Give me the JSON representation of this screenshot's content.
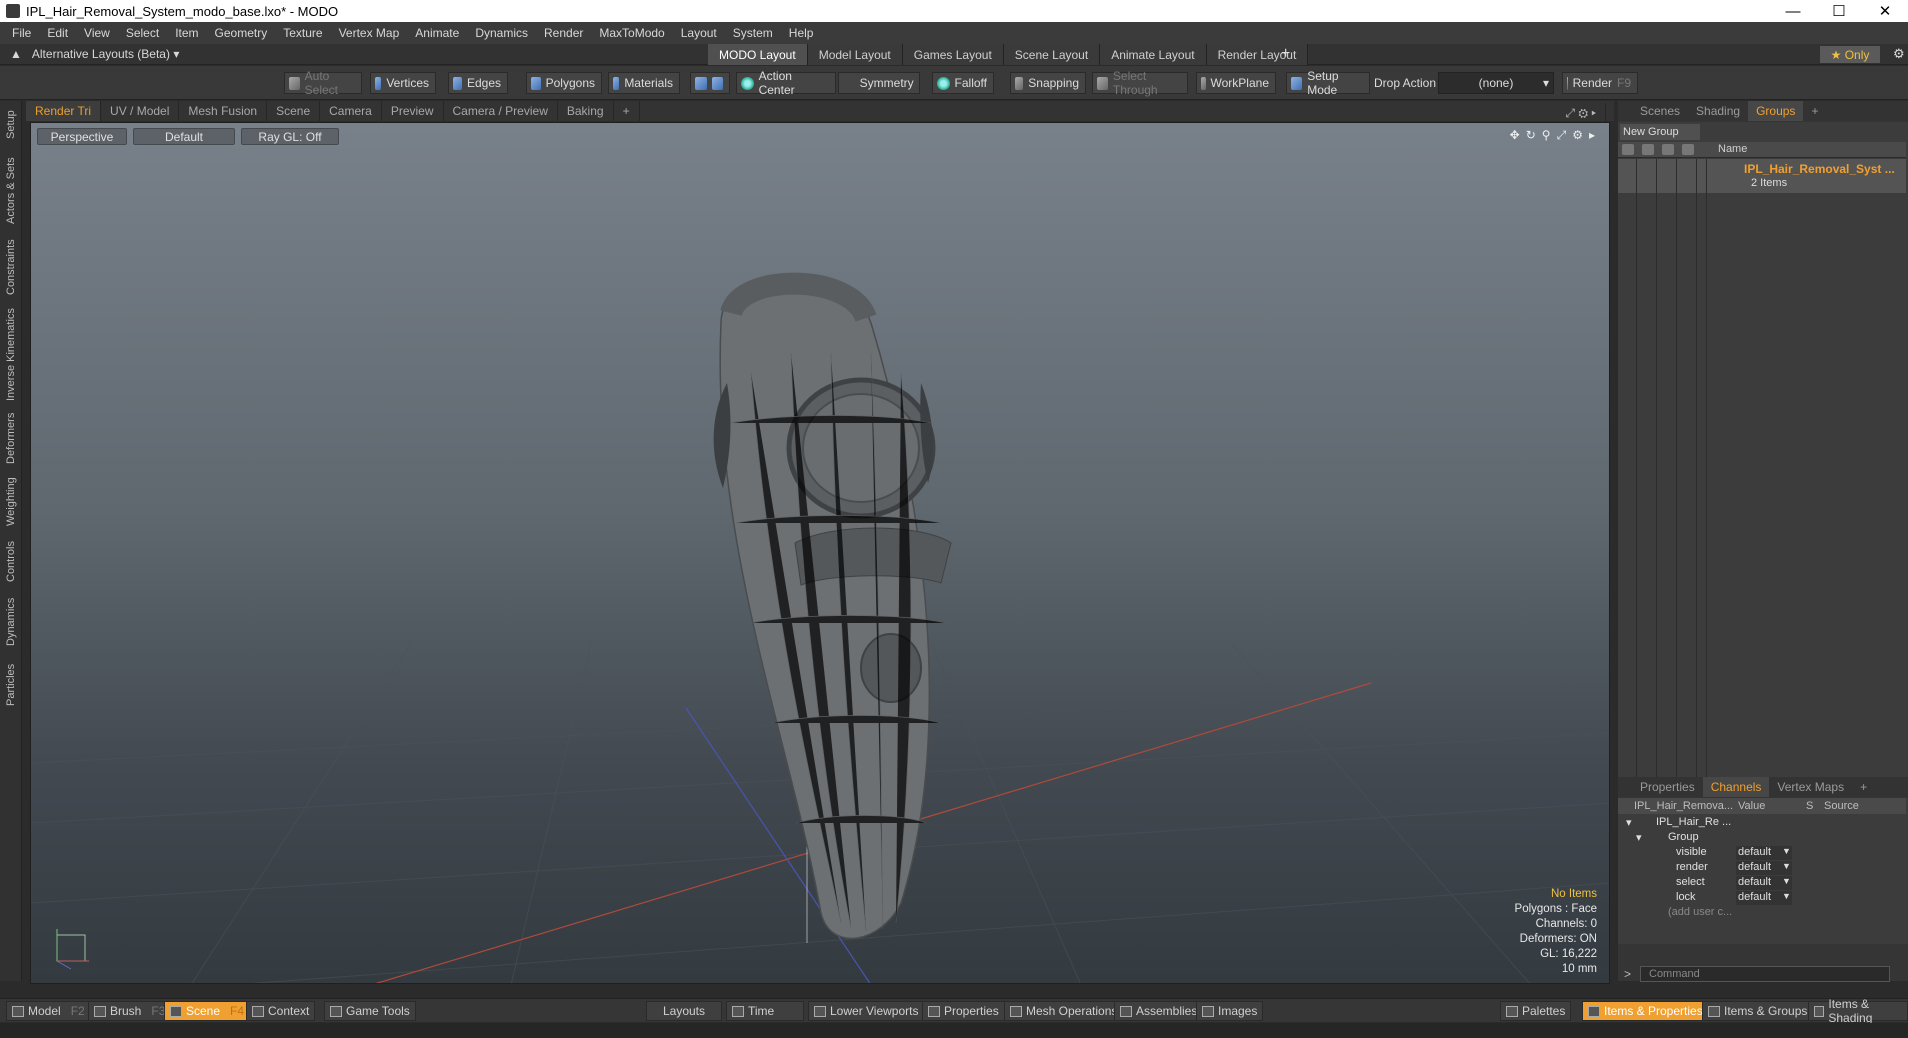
{
  "window": {
    "title": "IPL_Hair_Removal_System_modo_base.lxo* - MODO"
  },
  "menu": [
    "File",
    "Edit",
    "View",
    "Select",
    "Item",
    "Geometry",
    "Texture",
    "Vertex Map",
    "Animate",
    "Dynamics",
    "Render",
    "MaxToModo",
    "Layout",
    "System",
    "Help"
  ],
  "layouts": {
    "alternative": "Alternative Layouts (Beta)",
    "tabs": [
      "MODO Layout",
      "Model Layout",
      "Games Layout",
      "Scene Layout",
      "Animate Layout",
      "Render Layout"
    ],
    "active_tab": "MODO Layout",
    "only_label": "Only"
  },
  "toolbar": {
    "auto_select": "Auto Select",
    "vertices": "Vertices",
    "edges": "Edges",
    "polygons": "Polygons",
    "materials": "Materials",
    "action_center": "Action Center",
    "symmetry": "Symmetry",
    "falloff": "Falloff",
    "snapping": "Snapping",
    "select_through": "Select Through",
    "workplane": "WorkPlane",
    "setup_mode": "Setup Mode",
    "drop_action_label": "Drop Action",
    "drop_action_value": "(none)",
    "render": "Render",
    "render_key": "F9"
  },
  "left_tabs": [
    "Setup",
    "Actors & Sets",
    "Constraints",
    "Inverse Kinematics",
    "Deformers",
    "Weighting",
    "Controls",
    "Dynamics",
    "Particles"
  ],
  "viewport_tabs": [
    "Render Tri",
    "UV / Model",
    "Mesh Fusion",
    "Scene",
    "Camera",
    "Preview",
    "Camera / Preview",
    "Baking",
    "+"
  ],
  "viewport": {
    "view": "Perspective",
    "shading": "Default",
    "raygl": "Ray GL: Off",
    "info": {
      "items": "No Items",
      "polygons": "Polygons : Face",
      "channels": "Channels: 0",
      "deformers": "Deformers: ON",
      "gl": "GL: 16,222",
      "scale": "10 mm"
    }
  },
  "right_panel": {
    "top_tabs": [
      "Scenes",
      "Shading",
      "Groups",
      "+"
    ],
    "active_top": "Groups",
    "new_group": "New Group",
    "name_header": "Name",
    "group_name": "IPL_Hair_Removal_Syst ...",
    "group_count": "2 Items",
    "bottom_tabs": [
      "Properties",
      "Channels",
      "Vertex Maps",
      "+"
    ],
    "active_bottom": "Channels",
    "channels_header": {
      "name": "IPL_Hair_Remova...",
      "value": "Value",
      "s": "S",
      "source": "Source"
    },
    "tree_root": "IPL_Hair_Re ...",
    "tree_group": "Group",
    "channels": [
      {
        "name": "visible",
        "value": "default"
      },
      {
        "name": "render",
        "value": "default"
      },
      {
        "name": "select",
        "value": "default"
      },
      {
        "name": "lock",
        "value": "default"
      }
    ],
    "add_user": "(add user c...",
    "command_placeholder": "Command"
  },
  "bottom_bar": {
    "model": "Model",
    "model_key": "F2",
    "brush": "Brush",
    "brush_key": "F3",
    "scene": "Scene",
    "scene_key": "F4",
    "context": "Context",
    "game_tools": "Game Tools",
    "layouts": "Layouts",
    "time": "Time",
    "lower_viewports": "Lower Viewports",
    "properties": "Properties",
    "mesh_operations": "Mesh Operations",
    "assemblies": "Assemblies",
    "images": "Images",
    "palettes": "Palettes",
    "items_properties": "Items & Properties",
    "items_groups": "Items & Groups",
    "items_shading": "Items & Shading"
  },
  "colors": {
    "accent": "#f0a030",
    "highlight": "#f0c040"
  }
}
